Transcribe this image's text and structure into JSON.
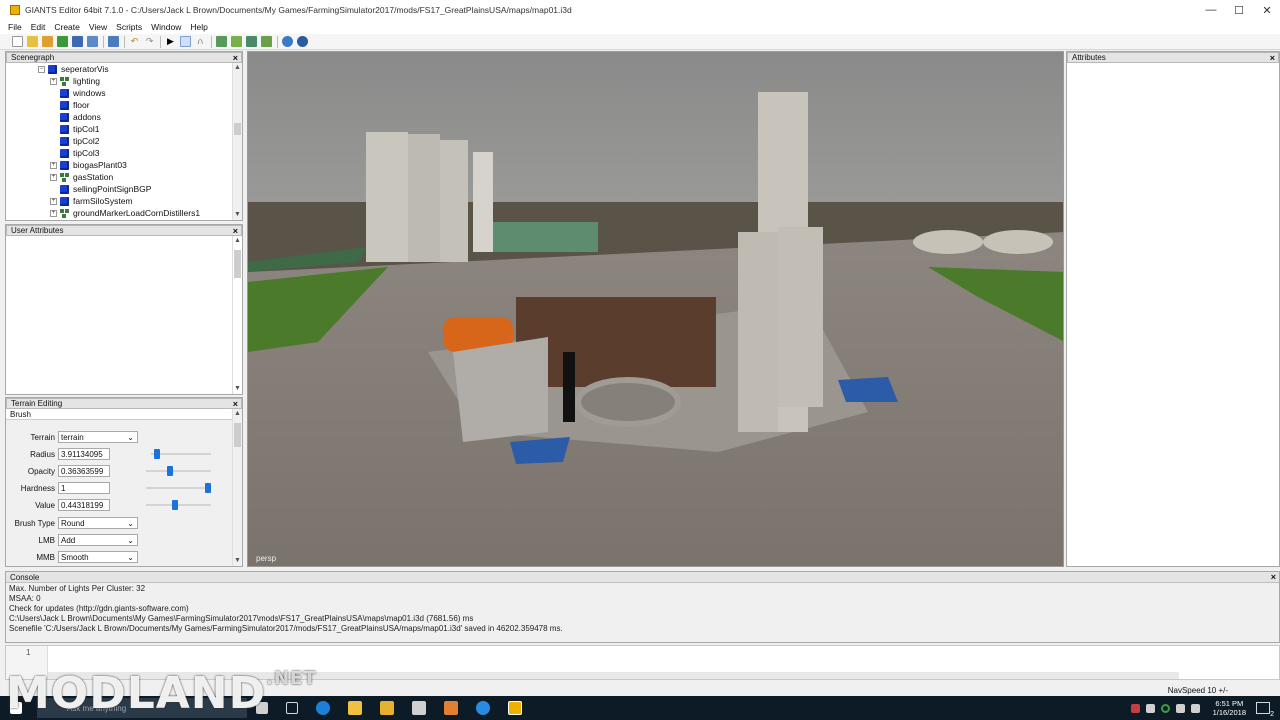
{
  "window": {
    "title": "GIANTS Editor 64bit 7.1.0 - C:/Users/Jack L Brown/Documents/My Games/FarmingSimulator2017/mods/FS17_GreatPlainsUSA/maps/map01.i3d"
  },
  "menu": [
    "File",
    "Edit",
    "Create",
    "View",
    "Scripts",
    "Window",
    "Help"
  ],
  "scenegraph": {
    "title": "Scenegraph",
    "items": [
      {
        "label": "seperatorVis",
        "icon": "cube",
        "expander": "minus"
      },
      {
        "label": "lighting",
        "icon": "group",
        "expander": "plus"
      },
      {
        "label": "windows",
        "icon": "cube",
        "expander": ""
      },
      {
        "label": "floor",
        "icon": "cube",
        "expander": ""
      },
      {
        "label": "addons",
        "icon": "cube",
        "expander": ""
      },
      {
        "label": "tipCol1",
        "icon": "cube",
        "expander": ""
      },
      {
        "label": "tipCol2",
        "icon": "cube",
        "expander": ""
      },
      {
        "label": "tipCol3",
        "icon": "cube",
        "expander": ""
      },
      {
        "label": "biogasPlant03",
        "icon": "cube",
        "expander": "plus"
      },
      {
        "label": "gasStation",
        "icon": "group",
        "expander": "plus"
      },
      {
        "label": "sellingPointSignBGP",
        "icon": "cube",
        "expander": ""
      },
      {
        "label": "farmSiloSystem",
        "icon": "cube",
        "expander": "plus"
      },
      {
        "label": "groundMarkerLoadCornDistillers1",
        "icon": "group",
        "expander": "plus"
      }
    ]
  },
  "user_attributes": {
    "title": "User Attributes"
  },
  "terrain_editing": {
    "title": "Terrain Editing",
    "section": "Brush",
    "terrain": {
      "label": "Terrain",
      "value": "terrain"
    },
    "radius": {
      "label": "Radius",
      "value": "3.91134095",
      "level": 0.05
    },
    "opacity": {
      "label": "Opacity",
      "value": "0.36363599",
      "level": 0.36
    },
    "hardness": {
      "label": "Hardness",
      "value": "1",
      "level": 1.0
    },
    "value": {
      "label": "Value",
      "value": "0.44318199",
      "level": 0.44
    },
    "brush_type": {
      "label": "Brush Type",
      "value": "Round"
    },
    "lmb": {
      "label": "LMB",
      "value": "Add"
    },
    "mmb": {
      "label": "MMB",
      "value": "Smooth"
    }
  },
  "viewport": {
    "camera": "persp"
  },
  "attributes": {
    "title": "Attributes"
  },
  "console": {
    "title": "Console",
    "lines": [
      " Max. Number of Lights Per Cluster: 32",
      " MSAA: 0",
      "Check for updates (http://gdn.giants-software.com)",
      "C:\\Users\\Jack L Brown\\Documents\\My Games\\FarmingSimulator2017\\mods\\FS17_GreatPlainsUSA\\maps\\map01.i3d (7681.56) ms",
      "Scenefile 'C:/Users/Jack L Brown/Documents/My Games/FarmingSimulator2017/mods/FS17_GreatPlainsUSA/maps/map01.i3d' saved in 46202.359478 ms."
    ]
  },
  "script": {
    "line_number": "1"
  },
  "status": {
    "navspeed": "NavSpeed 10 +/-"
  },
  "taskbar": {
    "time": "6:51 PM",
    "date": "1/16/2018",
    "notifications": "2",
    "search_placeholder": "Ask me anything"
  },
  "watermark": {
    "text": "MODLAND",
    "suffix": ".NET"
  },
  "colors": {
    "accent": "#1a73d8",
    "taskbar": "#0d1b26",
    "cube": "#1a3fd0"
  }
}
